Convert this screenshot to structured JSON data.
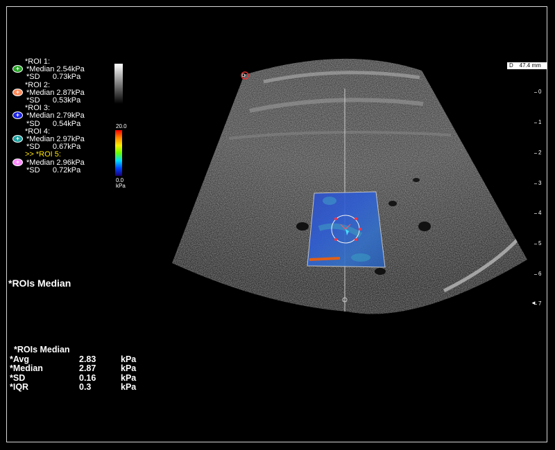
{
  "rois": [
    {
      "title": "*ROI 1:",
      "median": "*Median 2.54kPa",
      "sd": "*SD      0.73kPa",
      "color": "#2aa52a",
      "active": false
    },
    {
      "title": "*ROI 2:",
      "median": "*Median 2.87kPa",
      "sd": "*SD      0.53kPa",
      "color": "#ff8a5a",
      "active": false
    },
    {
      "title": "*ROI 3:",
      "median": "*Median 2.79kPa",
      "sd": "*SD      0.54kPa",
      "color": "#1b22e0",
      "active": false
    },
    {
      "title": "*ROI 4:",
      "median": "*Median 2.97kPa",
      "sd": "*SD      0.67kPa",
      "color": "#20a0a0",
      "active": false
    },
    {
      "title": ">> *ROI 5:",
      "median": "*Median 2.96kPa",
      "sd": "*SD      0.72kPa",
      "color": "#ff88ff",
      "active": true
    }
  ],
  "color_scale": {
    "max": "20.0",
    "min": "0.0",
    "unit": "kPa"
  },
  "rois_median_heading": "*ROIs Median",
  "summary": {
    "heading": "*ROIs Median",
    "rows": [
      {
        "label": "*Avg",
        "value": "2.83",
        "unit": "kPa"
      },
      {
        "label": "*Median",
        "value": "2.87",
        "unit": "kPa"
      },
      {
        "label": "*SD",
        "value": "0.16",
        "unit": "kPa"
      },
      {
        "label": "*IQR",
        "value": "0.3",
        "unit": "kPa"
      }
    ]
  },
  "depth_readout": "D    47.4 mm",
  "depth_ticks": [
    "0",
    "1",
    "2",
    "3",
    "4",
    "5",
    "6",
    "7"
  ],
  "depth_marker": "◄",
  "roi_plus_symbol": "+",
  "probe_marker": "P"
}
